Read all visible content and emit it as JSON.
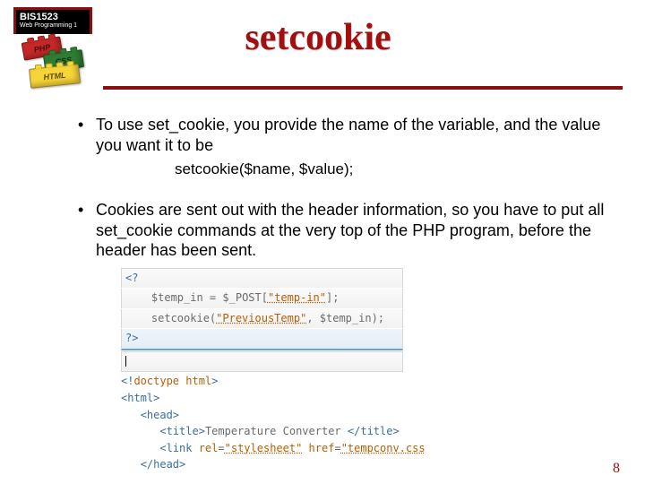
{
  "course": {
    "code": "BIS1523",
    "name": "Web Programming 1"
  },
  "lego": {
    "red": "PHP",
    "green": "CSS",
    "yellow": "HTML"
  },
  "title": "setcookie",
  "bullets": [
    "To use set_cookie, you provide the name of the variable, and the value you want it to be",
    "Cookies are sent out with the header information, so you have to put all set_cookie commands at the very top of the PHP program, before the header has been sent."
  ],
  "code_inline": "setcookie($name, $value);",
  "snippet": {
    "l1_open": "<?",
    "l2_var": "$temp_in",
    "l2_eq": " = ",
    "l2_post": "$_POST",
    "l2_br_open": "[",
    "l2_key": "\"temp-in\"",
    "l2_br_close": "];",
    "l3_fn": "setcookie(",
    "l3_arg1": "\"PreviousTemp\"",
    "l3_comma": ", ",
    "l3_arg2": "$temp_in",
    "l3_close": ");",
    "l4_close": "?>",
    "l5_doctype_open": "<!",
    "l5_doctype": "doctype html",
    "l5_doctype_close": ">",
    "l6": "<html>",
    "l7": "<head>",
    "l8_open": "<title>",
    "l8_text": "Temperature Converter ",
    "l8_close": "</title>",
    "l9_open": "<link",
    "l9_attr1": " rel",
    "l9_eq": "=",
    "l9_val1": "\"stylesheet\"",
    "l9_attr2": " href",
    "l9_val2": "\"tempconv.css",
    "l10": "</head>"
  },
  "page_number": "8"
}
